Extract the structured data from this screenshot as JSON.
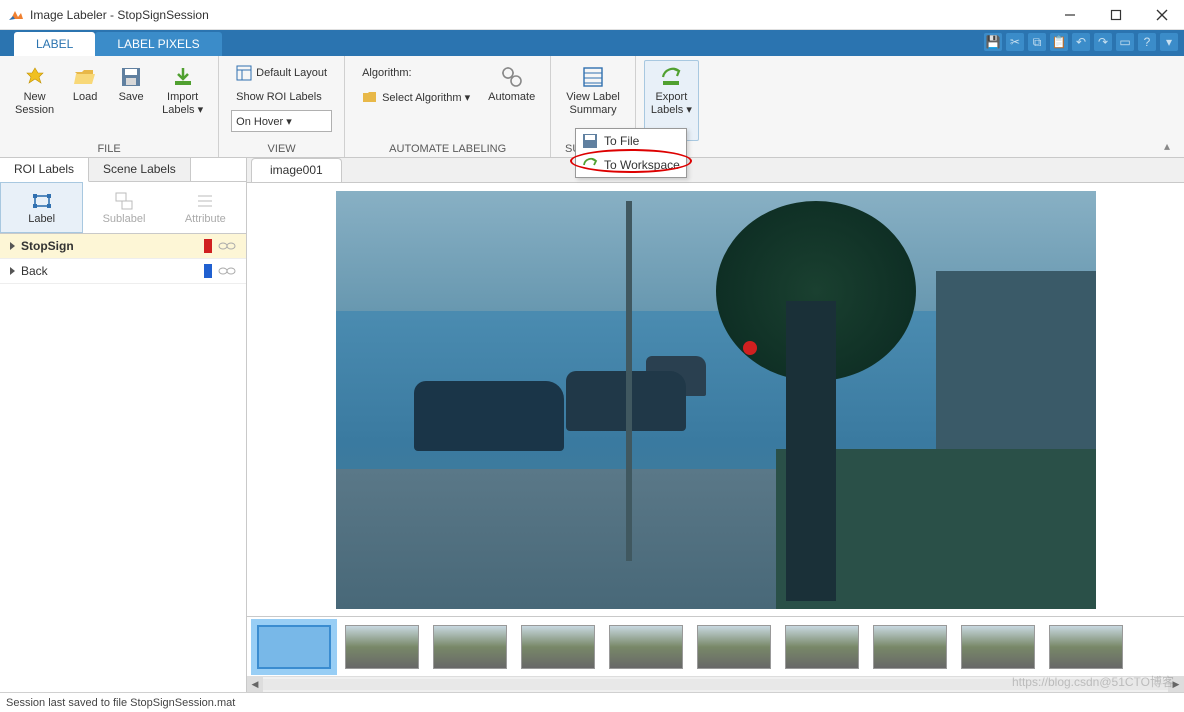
{
  "window": {
    "title": "Image Labeler - StopSignSession"
  },
  "tabs": {
    "label": "LABEL",
    "label_pixels": "LABEL PIXELS"
  },
  "ribbon": {
    "file": {
      "title": "FILE",
      "new_session": "New\nSession",
      "load": "Load",
      "save": "Save",
      "import": "Import\nLabels ▾"
    },
    "view": {
      "title": "VIEW",
      "default_layout": "Default Layout",
      "show_roi": "Show ROI Labels",
      "on_hover": "On Hover ▾"
    },
    "automate": {
      "title": "AUTOMATE LABELING",
      "algorithm": "Algorithm:",
      "select_algorithm": "Select Algorithm ▾",
      "automate": "Automate"
    },
    "summary": {
      "title": "SUMMARY",
      "view_label": "View Label\nSummary"
    },
    "export": {
      "title": "",
      "export_labels": "Export\nLabels ▾"
    }
  },
  "export_menu": {
    "to_file": "To File",
    "to_workspace": "To Workspace"
  },
  "left": {
    "roi_labels": "ROI Labels",
    "scene_labels": "Scene Labels",
    "tool_label": "Label",
    "tool_sublabel": "Sublabel",
    "tool_attribute": "Attribute",
    "rows": [
      {
        "name": "StopSign",
        "color": "#d02020"
      },
      {
        "name": "Back",
        "color": "#2060d0"
      }
    ]
  },
  "image_tab": "image001",
  "statusbar": "Session last saved to file StopSignSession.mat",
  "watermark": "https://blog.csdn@51CTO博客"
}
